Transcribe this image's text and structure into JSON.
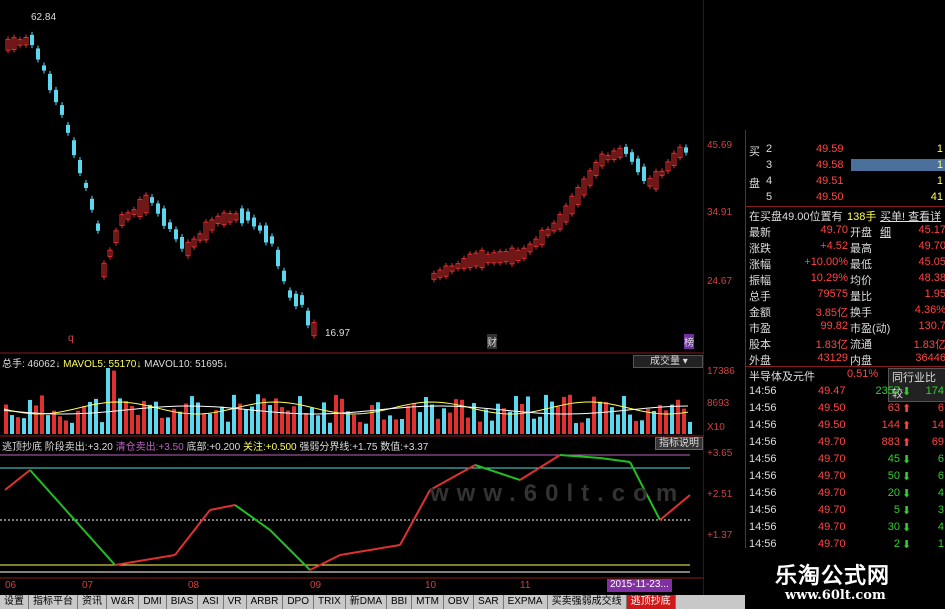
{
  "price_chart": {
    "high_label": "62.84",
    "low_label": "16.97",
    "scale": [
      "34.91",
      "24.67"
    ],
    "top_scale": "45.69",
    "markers": [
      "q",
      "财",
      "榜"
    ]
  },
  "volume_panel": {
    "total_label": "总手: 46062",
    "mavol5_label": "MAVOL5: 55170",
    "mavol10_label": "MAVOL10: 51695",
    "dropdown_label": "成交量",
    "scale": [
      "17386",
      "8693",
      "X10"
    ]
  },
  "indicator_panel": {
    "name": "逃顶抄底",
    "items": [
      {
        "label": "阶段卖出:",
        "value": "+3.20"
      },
      {
        "label": "清仓卖出:",
        "value": "+3.50"
      },
      {
        "label": "底部:",
        "value": "+0.200"
      },
      {
        "label": "关注:",
        "value": "+0.500"
      },
      {
        "label": "强弱分界线:",
        "value": "+1.75"
      },
      {
        "label": "数值:",
        "value": "+3.37"
      }
    ],
    "help_button": "指标说明",
    "scale": [
      "+3.65",
      "+2.51",
      "+1.37"
    ],
    "watermark": "www.60lt.com"
  },
  "x_axis": {
    "labels": [
      "06",
      "07",
      "08",
      "09",
      "10",
      "11"
    ],
    "cursor_date": "2015-11-23..."
  },
  "quote_panel": {
    "order_book": [
      {
        "side": "买",
        "level": "2",
        "price": "49.59",
        "vol": "1"
      },
      {
        "side": "",
        "level": "3",
        "price": "49.58",
        "vol": "1"
      },
      {
        "side": "盘",
        "level": "4",
        "price": "49.51",
        "vol": "1"
      },
      {
        "side": "",
        "level": "5",
        "price": "49.50",
        "vol": "41"
      }
    ],
    "bid_note": "在买盘49.00位置有",
    "bid_note_qty": "138手",
    "bid_note_link": "买单! 查看详细",
    "stats": [
      {
        "l1": "最新",
        "v1": "49.70",
        "l2": "开盘",
        "v2": "45.17"
      },
      {
        "l1": "涨跌",
        "v1": "+4.52",
        "l2": "最高",
        "v2": "49.70"
      },
      {
        "l1": "涨幅",
        "v1": "+10.00%",
        "l2": "最低",
        "v2": "45.05"
      },
      {
        "l1": "振幅",
        "v1": "10.29%",
        "l2": "均价",
        "v2": "48.38"
      },
      {
        "l1": "总手",
        "v1": "79575",
        "l2": "量比",
        "v2": "1.95"
      },
      {
        "l1": "金额",
        "v1": "3.85亿",
        "l2": "换手",
        "v2": "4.36%"
      },
      {
        "l1": "市盈",
        "v1": "99.82",
        "l2": "市盈(动)",
        "v2": "130.7"
      },
      {
        "l1": "股本",
        "v1": "1.83亿",
        "l2": "流通",
        "v2": "1.83亿"
      },
      {
        "l1": "外盘",
        "v1": "43129",
        "l2": "内盘",
        "v2": "36446"
      }
    ],
    "sector_name": "半导体及元件",
    "sector_pct": "0.51%",
    "sector_compare": "同行业比较",
    "ticks": [
      {
        "time": "14:56",
        "price": "49.47",
        "vol": "2357",
        "dir": "down",
        "extra": "174"
      },
      {
        "time": "14:56",
        "price": "49.50",
        "vol": "63",
        "dir": "up",
        "extra": "6"
      },
      {
        "time": "14:56",
        "price": "49.50",
        "vol": "144",
        "dir": "up",
        "extra": "14"
      },
      {
        "time": "14:56",
        "price": "49.70",
        "vol": "883",
        "dir": "up",
        "extra": "69"
      },
      {
        "time": "14:56",
        "price": "49.70",
        "vol": "45",
        "dir": "down",
        "extra": "6"
      },
      {
        "time": "14:56",
        "price": "49.70",
        "vol": "50",
        "dir": "down",
        "extra": "6"
      },
      {
        "time": "14:56",
        "price": "49.70",
        "vol": "20",
        "dir": "down",
        "extra": "4"
      },
      {
        "time": "14:56",
        "price": "49.70",
        "vol": "5",
        "dir": "down",
        "extra": "3"
      },
      {
        "time": "14:56",
        "price": "49.70",
        "vol": "30",
        "dir": "down",
        "extra": "4"
      },
      {
        "time": "14:56",
        "price": "49.70",
        "vol": "2",
        "dir": "down",
        "extra": "1"
      }
    ]
  },
  "tabs": [
    "设置",
    "指标平台",
    "资讯",
    "W&R",
    "DMI",
    "BIAS",
    "ASI",
    "VR",
    "ARBR",
    "DPO",
    "TRIX",
    "新DMA",
    "BBI",
    "MTM",
    "OBV",
    "SAR",
    "EXPMA",
    "买卖强弱成交线",
    "逃顶抄底"
  ],
  "watermark_box": {
    "title": "乐淘公式网",
    "url": "www.60lt.com"
  },
  "colors": {
    "up": "#e03030",
    "down": "#5bd8f0",
    "indicator_line_up": "#e03030",
    "indicator_line_down": "#20c020",
    "magenta": "#c060c0"
  }
}
